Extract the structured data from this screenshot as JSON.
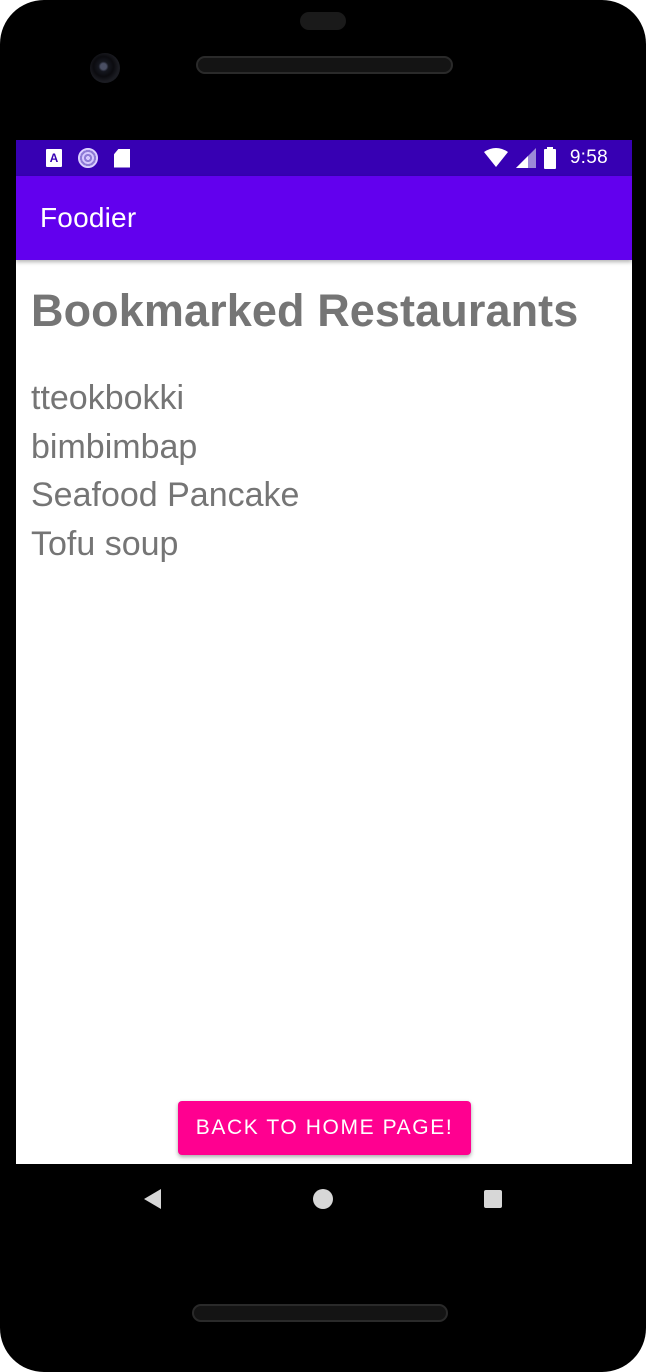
{
  "status_bar": {
    "time": "9:58",
    "left_icons": [
      "a-notification-icon",
      "sync-icon",
      "sd-card-icon"
    ],
    "right_icons": [
      "wifi-icon",
      "signal-icon",
      "battery-icon"
    ],
    "background_color": "#3700b3"
  },
  "app_bar": {
    "title": "Foodier",
    "background_color": "#6200ee"
  },
  "main": {
    "title": "Bookmarked Restaurants",
    "bookmarks": [
      "tteokbokki",
      "bimbimbap",
      "Seafood Pancake",
      "Tofu soup"
    ],
    "text_color": "#757575"
  },
  "actions": {
    "back_label": "BACK TO HOME PAGE!",
    "button_color": "#ff0090"
  },
  "nav_bar": {
    "icons": [
      "back-icon",
      "home-icon",
      "recents-icon"
    ]
  }
}
